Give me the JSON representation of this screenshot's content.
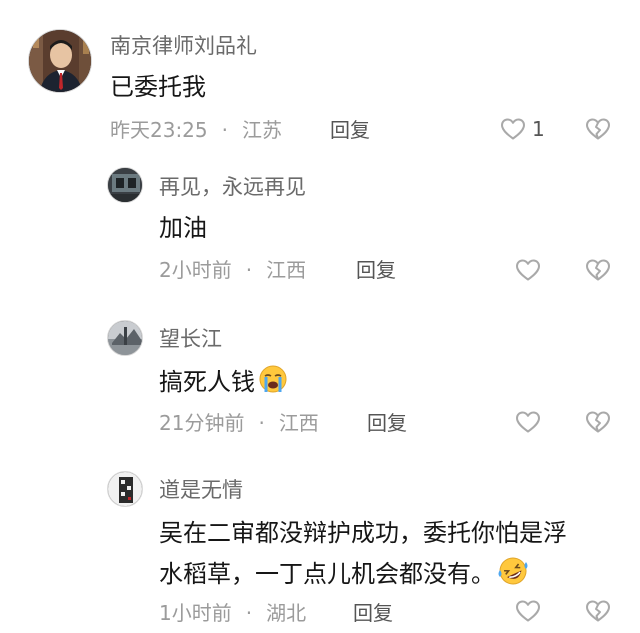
{
  "comments": [
    {
      "name": "南京律师刘品礼",
      "text": "已委托我",
      "time": "昨天23:25",
      "dot": "·",
      "location": "江苏",
      "reply": "回复",
      "likes": "1"
    },
    {
      "name": "再见，永远再见",
      "text": "加油",
      "time": "2小时前",
      "dot": "·",
      "location": "江西",
      "reply": "回复"
    },
    {
      "name": "望长江",
      "text": "搞死人钱",
      "time": "21分钟前",
      "dot": "·",
      "location": "江西",
      "reply": "回复"
    },
    {
      "name": "道是无情",
      "text_line1": "吴在二审都没辩护成功，委托你怕是浮",
      "text_line2": "水稻草，一丁点儿机会都没有。",
      "time": "1小时前",
      "dot": "·",
      "location": "湖北",
      "reply": "回复"
    }
  ],
  "icons": {
    "like": "heart-outline-icon",
    "dislike": "broken-heart-icon",
    "emoji_cry": "loudly-crying-face-icon",
    "emoji_laugh": "rolling-laughing-face-icon"
  },
  "colors": {
    "name": "#6a6a6a",
    "text": "#161616",
    "meta": "#9b9b9b",
    "icon": "#a9a9a9"
  }
}
